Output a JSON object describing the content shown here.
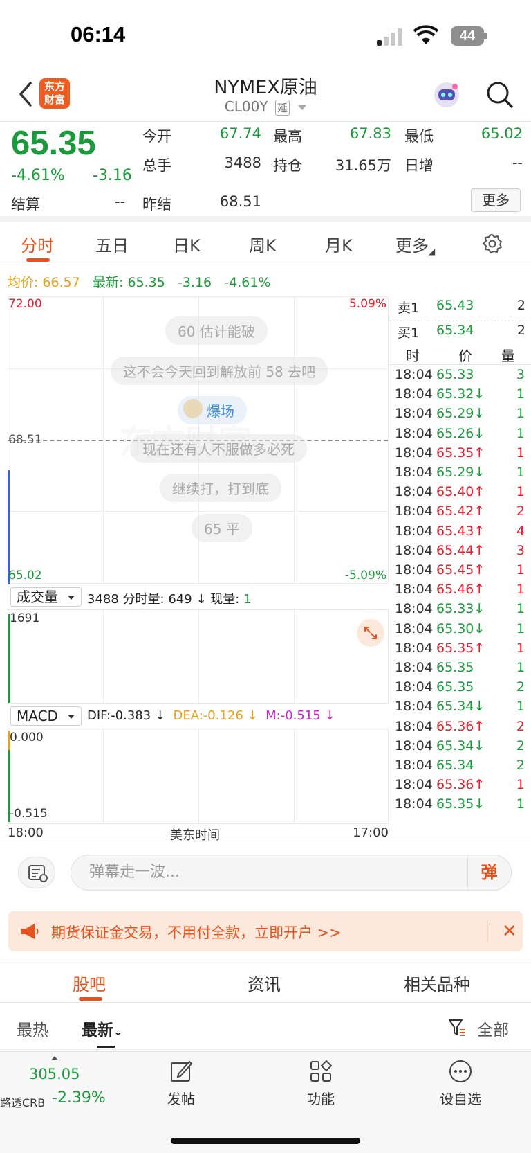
{
  "status_bar": {
    "time": "06:14",
    "battery": "44"
  },
  "header": {
    "logo_line1": "东方",
    "logo_line2": "财富",
    "title": "NYMEX原油",
    "code": "CL00Y",
    "delay_tag": "延"
  },
  "quote": {
    "price": "65.35",
    "change_pct": "-4.61%",
    "change": "-3.16",
    "settle_label": "结算",
    "settle_value": "--",
    "cells": {
      "open_label": "今开",
      "open_value": "67.74",
      "high_label": "最高",
      "high_value": "67.83",
      "low_label": "最低",
      "low_value": "65.02",
      "volume_label": "总手",
      "volume_value": "3488",
      "oi_label": "持仓",
      "oi_value": "31.65万",
      "daily_inc_label": "日增",
      "daily_inc_value": "--",
      "prev_settle_label": "昨结",
      "prev_settle_value": "68.51"
    },
    "more_label": "更多",
    "colors": {
      "down": "#1a9a3a",
      "up": "#e0202c",
      "accent": "#e8501c"
    }
  },
  "tabs": {
    "items": [
      "分时",
      "五日",
      "日K",
      "周K",
      "月K",
      "更多"
    ],
    "active": "分时"
  },
  "intraday": {
    "avg_label": "均价:",
    "avg_value": "66.57",
    "latest_label": "最新:",
    "latest_value": "65.35",
    "latest_change": "-3.16",
    "latest_pct": "-4.61%",
    "y_top": "72.00",
    "y_bottom": "65.02",
    "y_mid": "68.51",
    "pct_top": "5.09%",
    "pct_bottom": "-5.09%",
    "danmu": [
      "60 估计能破",
      "这不会今天回到解放前 58 去吧",
      "爆场",
      "现在还有人不服做多必死",
      "继续打，打到底",
      "65 平"
    ]
  },
  "volume": {
    "selector": "成交量",
    "total": "3488",
    "fenshi_label": "分时量:",
    "fenshi_value": "649",
    "current_label": "现量:",
    "current_value": "1",
    "y_top": "1691"
  },
  "macd": {
    "selector": "MACD",
    "dif": "DIF:-0.383",
    "dea": "DEA:-0.126",
    "m": "M:-0.515",
    "y_top": "0.000",
    "y_bottom": "-0.515"
  },
  "time_axis": {
    "start": "18:00",
    "mid": "美东时间",
    "end": "17:00"
  },
  "order_book": {
    "ask_label": "卖1",
    "ask_price": "65.43",
    "ask_qty": "2",
    "bid_label": "买1",
    "bid_price": "65.34",
    "bid_qty": "2"
  },
  "ticks_header": {
    "time": "时",
    "price": "价",
    "qty": "量"
  },
  "ticks": [
    {
      "t": "18:04",
      "p": "65.33",
      "d": "",
      "v": "3"
    },
    {
      "t": "18:04",
      "p": "65.32",
      "d": "down",
      "v": "1"
    },
    {
      "t": "18:04",
      "p": "65.29",
      "d": "down",
      "v": "1"
    },
    {
      "t": "18:04",
      "p": "65.26",
      "d": "down",
      "v": "1"
    },
    {
      "t": "18:04",
      "p": "65.35",
      "d": "up",
      "v": "1"
    },
    {
      "t": "18:04",
      "p": "65.29",
      "d": "down",
      "v": "1"
    },
    {
      "t": "18:04",
      "p": "65.40",
      "d": "up",
      "v": "1"
    },
    {
      "t": "18:04",
      "p": "65.42",
      "d": "up",
      "v": "2"
    },
    {
      "t": "18:04",
      "p": "65.43",
      "d": "up",
      "v": "4"
    },
    {
      "t": "18:04",
      "p": "65.44",
      "d": "up",
      "v": "3"
    },
    {
      "t": "18:04",
      "p": "65.45",
      "d": "up",
      "v": "1"
    },
    {
      "t": "18:04",
      "p": "65.46",
      "d": "up",
      "v": "1"
    },
    {
      "t": "18:04",
      "p": "65.33",
      "d": "down",
      "v": "1"
    },
    {
      "t": "18:04",
      "p": "65.30",
      "d": "down",
      "v": "1"
    },
    {
      "t": "18:04",
      "p": "65.35",
      "d": "up",
      "v": "1"
    },
    {
      "t": "18:04",
      "p": "65.35",
      "d": "",
      "v": "1"
    },
    {
      "t": "18:04",
      "p": "65.35",
      "d": "",
      "v": "2"
    },
    {
      "t": "18:04",
      "p": "65.34",
      "d": "down",
      "v": "1"
    },
    {
      "t": "18:04",
      "p": "65.36",
      "d": "up",
      "v": "2"
    },
    {
      "t": "18:04",
      "p": "65.34",
      "d": "down",
      "v": "2"
    },
    {
      "t": "18:04",
      "p": "65.34",
      "d": "",
      "v": "2"
    },
    {
      "t": "18:04",
      "p": "65.36",
      "d": "up",
      "v": "1"
    },
    {
      "t": "18:04",
      "p": "65.35",
      "d": "down",
      "v": "1"
    }
  ],
  "comment": {
    "placeholder": "弹幕走一波...",
    "danmu_button": "弹"
  },
  "ad": {
    "text": "期货保证金交易，不用付全款，立即开户 >>"
  },
  "sections": {
    "items": [
      "股吧",
      "资讯",
      "相关品种"
    ]
  },
  "sort": {
    "hot": "最热",
    "latest": "最新",
    "all": "全部"
  },
  "bottom": {
    "index_value": "305.05",
    "index_name": "路透CRB",
    "index_pct": "-2.39%",
    "post": "发帖",
    "function": "功能",
    "watchlist": "设自选"
  }
}
